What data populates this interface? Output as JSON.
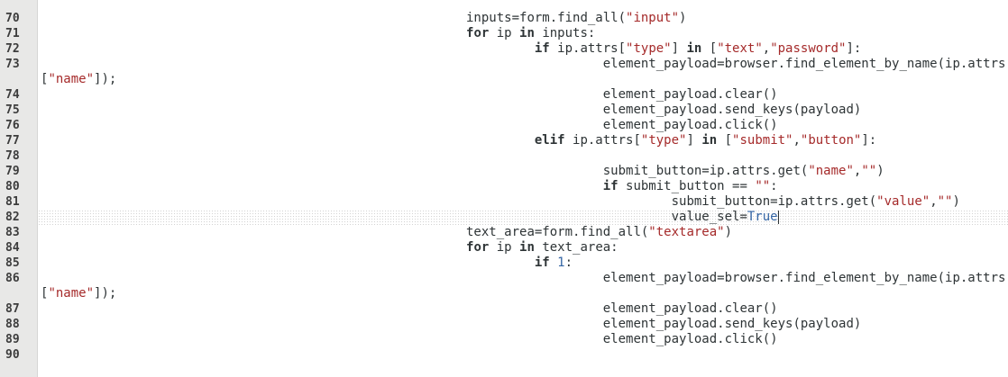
{
  "editor": {
    "current_line": "82",
    "line_numbers": [
      "70",
      "71",
      "72",
      "73",
      "",
      "74",
      "75",
      "76",
      "77",
      "78",
      "79",
      "80",
      "81",
      "82",
      "83",
      "84",
      "85",
      "86",
      "",
      "87",
      "88",
      "89",
      "90"
    ],
    "lines": [
      [
        {
          "t": "                                                        inputs=form.find_all(",
          "c": ""
        },
        {
          "t": "\"input\"",
          "c": "str"
        },
        {
          "t": ")",
          "c": ""
        }
      ],
      [
        {
          "t": "                                                        ",
          "c": ""
        },
        {
          "t": "for",
          "c": "kw"
        },
        {
          "t": " ip ",
          "c": ""
        },
        {
          "t": "in",
          "c": "kw"
        },
        {
          "t": " inputs:",
          "c": ""
        }
      ],
      [
        {
          "t": "                                                                 ",
          "c": ""
        },
        {
          "t": "if",
          "c": "kw"
        },
        {
          "t": " ip.attrs[",
          "c": ""
        },
        {
          "t": "\"type\"",
          "c": "str"
        },
        {
          "t": "] ",
          "c": ""
        },
        {
          "t": "in",
          "c": "kw"
        },
        {
          "t": " [",
          "c": ""
        },
        {
          "t": "\"text\"",
          "c": "str"
        },
        {
          "t": ",",
          "c": ""
        },
        {
          "t": "\"password\"",
          "c": "str"
        },
        {
          "t": "]:",
          "c": ""
        }
      ],
      [
        {
          "t": "                                                                          element_payload=browser.find_element_by_name(ip.attrs",
          "c": ""
        }
      ],
      [
        {
          "t": "[",
          "c": ""
        },
        {
          "t": "\"name\"",
          "c": "str"
        },
        {
          "t": "]);",
          "c": ""
        }
      ],
      [
        {
          "t": "                                                                          element_payload.clear()",
          "c": ""
        }
      ],
      [
        {
          "t": "                                                                          element_payload.send_keys(payload)",
          "c": ""
        }
      ],
      [
        {
          "t": "                                                                          element_payload.click()",
          "c": ""
        }
      ],
      [
        {
          "t": "                                                                 ",
          "c": ""
        },
        {
          "t": "elif",
          "c": "kw"
        },
        {
          "t": " ip.attrs[",
          "c": ""
        },
        {
          "t": "\"type\"",
          "c": "str"
        },
        {
          "t": "] ",
          "c": ""
        },
        {
          "t": "in",
          "c": "kw"
        },
        {
          "t": " [",
          "c": ""
        },
        {
          "t": "\"submit\"",
          "c": "str"
        },
        {
          "t": ",",
          "c": ""
        },
        {
          "t": "\"button\"",
          "c": "str"
        },
        {
          "t": "]:",
          "c": ""
        }
      ],
      [
        {
          "t": "",
          "c": ""
        }
      ],
      [
        {
          "t": "                                                                          submit_button=ip.attrs.get(",
          "c": ""
        },
        {
          "t": "\"name\"",
          "c": "str"
        },
        {
          "t": ",",
          "c": ""
        },
        {
          "t": "\"\"",
          "c": "str"
        },
        {
          "t": ")",
          "c": ""
        }
      ],
      [
        {
          "t": "                                                                          ",
          "c": ""
        },
        {
          "t": "if",
          "c": "kw"
        },
        {
          "t": " submit_button == ",
          "c": ""
        },
        {
          "t": "\"\"",
          "c": "str"
        },
        {
          "t": ":",
          "c": ""
        }
      ],
      [
        {
          "t": "                                                                                   submit_button=ip.attrs.get(",
          "c": ""
        },
        {
          "t": "\"value\"",
          "c": "str"
        },
        {
          "t": ",",
          "c": ""
        },
        {
          "t": "\"\"",
          "c": "str"
        },
        {
          "t": ")",
          "c": ""
        }
      ],
      [
        {
          "t": "                                                                                   value_sel=",
          "c": ""
        },
        {
          "t": "True",
          "c": "const"
        },
        {
          "t": "|CURSOR|",
          "c": "cursor"
        }
      ],
      [
        {
          "t": "                                                        text_area=form.find_all(",
          "c": ""
        },
        {
          "t": "\"textarea\"",
          "c": "str"
        },
        {
          "t": ")",
          "c": ""
        }
      ],
      [
        {
          "t": "                                                        ",
          "c": ""
        },
        {
          "t": "for",
          "c": "kw"
        },
        {
          "t": " ip ",
          "c": ""
        },
        {
          "t": "in",
          "c": "kw"
        },
        {
          "t": " text_area:",
          "c": ""
        }
      ],
      [
        {
          "t": "                                                                 ",
          "c": ""
        },
        {
          "t": "if",
          "c": "kw"
        },
        {
          "t": " ",
          "c": ""
        },
        {
          "t": "1",
          "c": "num"
        },
        {
          "t": ":",
          "c": ""
        }
      ],
      [
        {
          "t": "                                                                          element_payload=browser.find_element_by_name(ip.attrs",
          "c": ""
        }
      ],
      [
        {
          "t": "[",
          "c": ""
        },
        {
          "t": "\"name\"",
          "c": "str"
        },
        {
          "t": "]);",
          "c": ""
        }
      ],
      [
        {
          "t": "                                                                          element_payload.clear()",
          "c": ""
        }
      ],
      [
        {
          "t": "                                                                          element_payload.send_keys(payload)",
          "c": ""
        }
      ],
      [
        {
          "t": "                                                                          element_payload.click()",
          "c": ""
        }
      ],
      [
        {
          "t": "",
          "c": ""
        }
      ]
    ]
  }
}
